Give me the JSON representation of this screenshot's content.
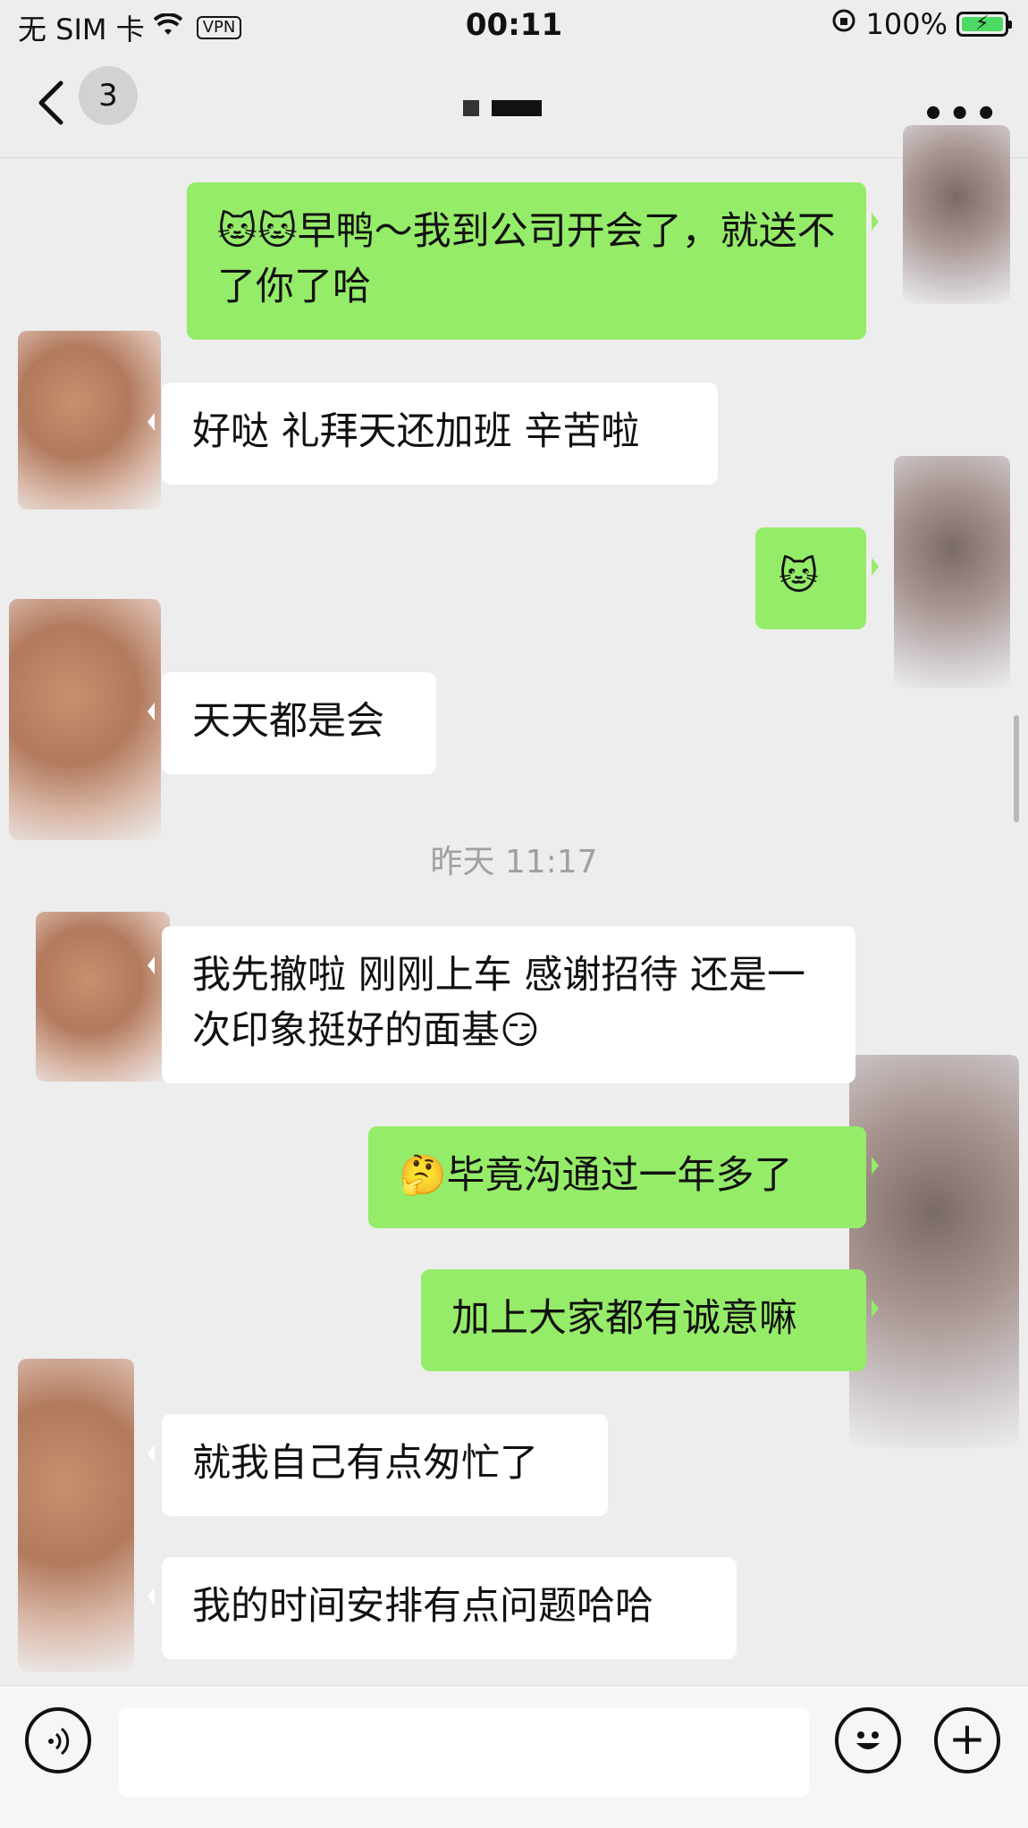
{
  "status": {
    "carrier": "无 SIM 卡",
    "wifi_icon": "wifi-icon",
    "vpn": "VPN",
    "time": "00:11",
    "battery": "100%",
    "battery_level": 1.0
  },
  "nav": {
    "back_icon": "chevron-left-icon",
    "unread_count": "3",
    "more_icon": "ellipsis-icon"
  },
  "messages": [
    {
      "side": "out",
      "text": "🐱🐱早鸭～我到公司开会了，就送不了你了哈"
    },
    {
      "side": "in",
      "text": "好哒 礼拜天还加班 辛苦啦"
    },
    {
      "side": "out",
      "text": "🐱"
    },
    {
      "side": "in",
      "text": "天天都是会"
    },
    {
      "side": "in",
      "text": "我先撤啦 刚刚上车 感谢招待 还是一次印象挺好的面基😏"
    },
    {
      "side": "out",
      "text": "🤔毕竟沟通过一年多了"
    },
    {
      "side": "out",
      "text": "加上大家都有诚意嘛"
    },
    {
      "side": "in",
      "text": "就我自己有点匆忙了"
    },
    {
      "side": "in",
      "text": "我的时间安排有点问题哈哈"
    }
  ],
  "timestamp": "昨天 11:17",
  "input": {
    "voice_icon": "voice-icon",
    "emoji_icon": "smiley-icon",
    "plus_icon": "plus-icon"
  },
  "colors": {
    "background": "#ededed",
    "outgoing_bubble": "#95ec69",
    "incoming_bubble": "#ffffff"
  }
}
